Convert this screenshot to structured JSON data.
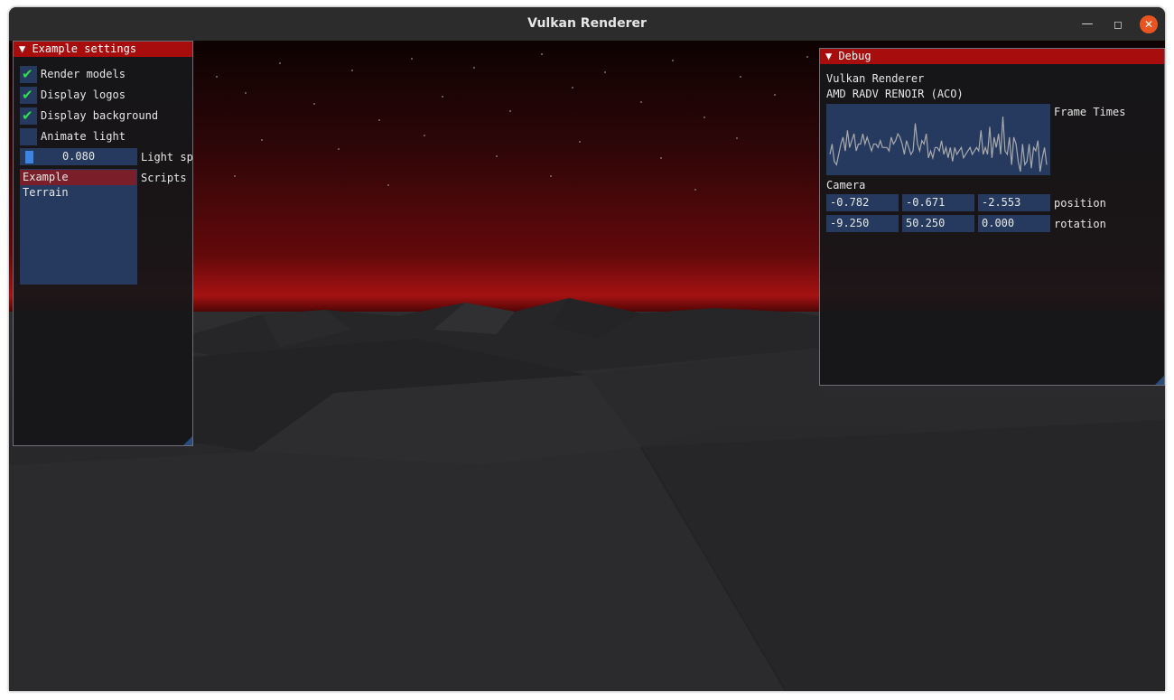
{
  "window": {
    "title": "Vulkan Renderer"
  },
  "settings_panel": {
    "header": "▼ Example settings",
    "checkboxes": [
      {
        "label": "Render models",
        "checked": true
      },
      {
        "label": "Display logos",
        "checked": true
      },
      {
        "label": "Display background",
        "checked": true
      },
      {
        "label": "Animate light",
        "checked": false
      }
    ],
    "slider": {
      "value": "0.080",
      "label": "Light sp"
    },
    "scripts": {
      "label": "Scripts",
      "items": [
        "Example",
        "Terrain"
      ],
      "selected": "Example"
    }
  },
  "debug_panel": {
    "header": "▼ Debug",
    "app_name": "Vulkan Renderer",
    "gpu": "AMD RADV RENOIR (ACO)",
    "frame_times_label": "Frame Times",
    "frame_times": [
      6,
      9,
      4,
      3,
      6,
      9,
      11,
      7,
      13,
      8,
      10,
      12,
      7,
      9,
      9,
      12,
      9,
      11,
      9,
      7,
      9,
      9,
      8,
      10,
      8,
      8,
      8,
      7,
      11,
      9,
      10,
      12,
      11,
      9,
      6,
      10,
      8,
      6,
      7,
      15,
      9,
      7,
      10,
      9,
      12,
      5,
      7,
      5,
      8,
      8,
      7,
      10,
      6,
      8,
      5,
      8,
      4,
      8,
      6,
      7,
      8,
      5,
      6,
      7,
      8,
      6,
      7,
      8,
      7,
      13,
      6,
      8,
      6,
      14,
      5,
      11,
      8,
      12,
      6,
      17,
      7,
      6,
      11,
      3,
      11,
      9,
      4,
      1,
      9,
      3,
      4,
      9,
      2,
      8,
      7,
      10,
      1,
      5,
      8,
      3
    ],
    "camera_label": "Camera",
    "position": {
      "label": "position",
      "values": [
        "-0.782",
        "-0.671",
        "-2.553"
      ]
    },
    "rotation": {
      "label": "rotation",
      "values": [
        "-9.250",
        "50.250",
        "0.000"
      ]
    }
  },
  "colors": {
    "header": "#a80d0d",
    "frame_bg": "#253a5e",
    "check": "#2ee04a",
    "selected": "#7a1f2a",
    "grab": "#3d85e0"
  }
}
